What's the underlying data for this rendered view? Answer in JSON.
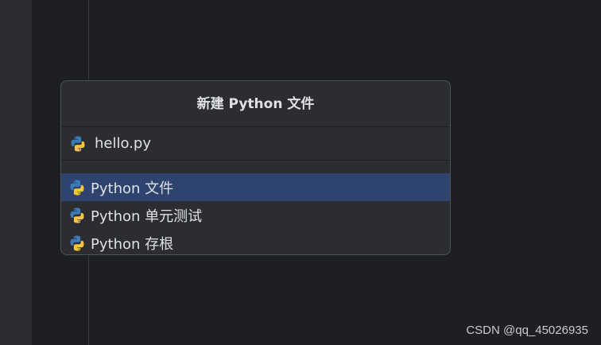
{
  "dialog": {
    "title": "新建 Python 文件",
    "file_name_value": "hello.py",
    "items": [
      {
        "label": "Python 文件",
        "selected": true
      },
      {
        "label": "Python 单元测试",
        "selected": false
      },
      {
        "label": "Python 存根",
        "selected": false
      }
    ]
  },
  "icons": {
    "file_type": "python-icon"
  },
  "colors": {
    "background": "#1e1f22",
    "dialog_bg": "#2b2d30",
    "selection": "#2e436e",
    "python_blue": "#3d7ab8",
    "python_yellow": "#f2c53d"
  },
  "watermark": "CSDN @qq_45026935"
}
